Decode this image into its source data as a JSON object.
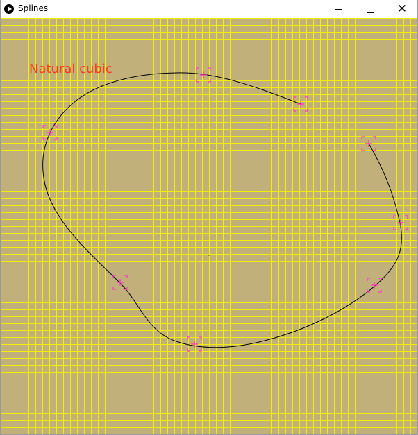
{
  "window": {
    "title": "Splines"
  },
  "titlebar_buttons": [
    {
      "name": "minimize-button",
      "icon": "minimize-icon"
    },
    {
      "name": "maximize-button",
      "icon": "maximize-icon"
    },
    {
      "name": "close-button",
      "icon": "close-icon"
    }
  ],
  "canvas": {
    "caption": "Natural cubic",
    "background_color": "#c2b07a",
    "grid_color": "#f2f000",
    "curve_color": "#000000",
    "marker_color": "#ff33cc",
    "caption_color": "#ff3b1a"
  }
}
